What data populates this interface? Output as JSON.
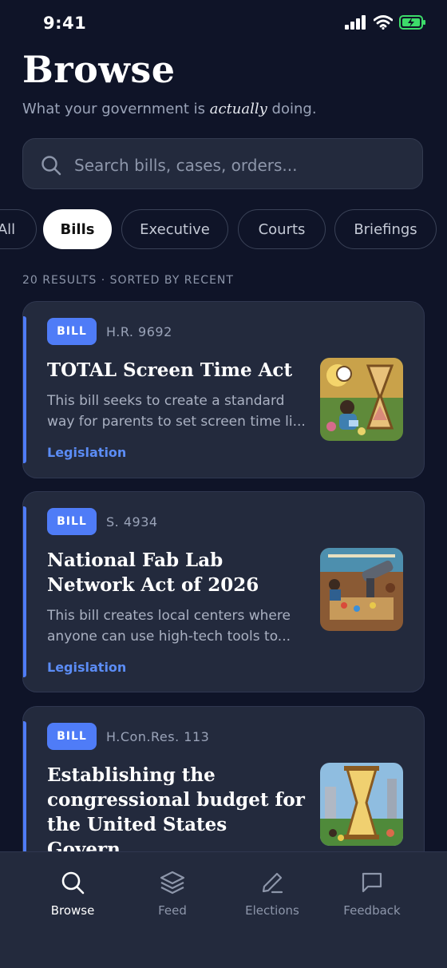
{
  "status_bar": {
    "time": "9:41"
  },
  "header": {
    "title": "Browse",
    "subtitle_prefix": "What your government is ",
    "subtitle_emphasis": "actually",
    "subtitle_suffix": " doing."
  },
  "search": {
    "placeholder": "Search bills, cases, orders..."
  },
  "filters": [
    "All",
    "Bills",
    "Executive",
    "Courts",
    "Briefings"
  ],
  "selected_filter": "Bills",
  "results_meta": "20 RESULTS · SORTED BY RECENT",
  "cards": [
    {
      "badge": "BILL",
      "number": "H.R. 9692",
      "title": "TOTAL Screen Time Act",
      "description": "This bill seeks to create a standard way for parents to set screen time li...",
      "tag": "Legislation"
    },
    {
      "badge": "BILL",
      "number": "S. 4934",
      "title": "National Fab Lab Network Act of 2026",
      "description": "This bill creates local centers where anyone can use high-tech tools to...",
      "tag": "Legislation"
    },
    {
      "badge": "BILL",
      "number": "H.Con.Res. 113",
      "title": "Establishing the congressional budget for the United States Govern...",
      "description": "",
      "tag": ""
    }
  ],
  "tabbar": {
    "items": [
      {
        "label": "Browse",
        "icon": "search-icon"
      },
      {
        "label": "Feed",
        "icon": "layers-icon"
      },
      {
        "label": "Elections",
        "icon": "pen-icon"
      },
      {
        "label": "Feedback",
        "icon": "message-icon"
      }
    ],
    "active": "Browse"
  },
  "colors": {
    "background": "#0f1428",
    "card": "#232a3d",
    "accent": "#4f7cf7",
    "link": "#5b8cf5"
  }
}
